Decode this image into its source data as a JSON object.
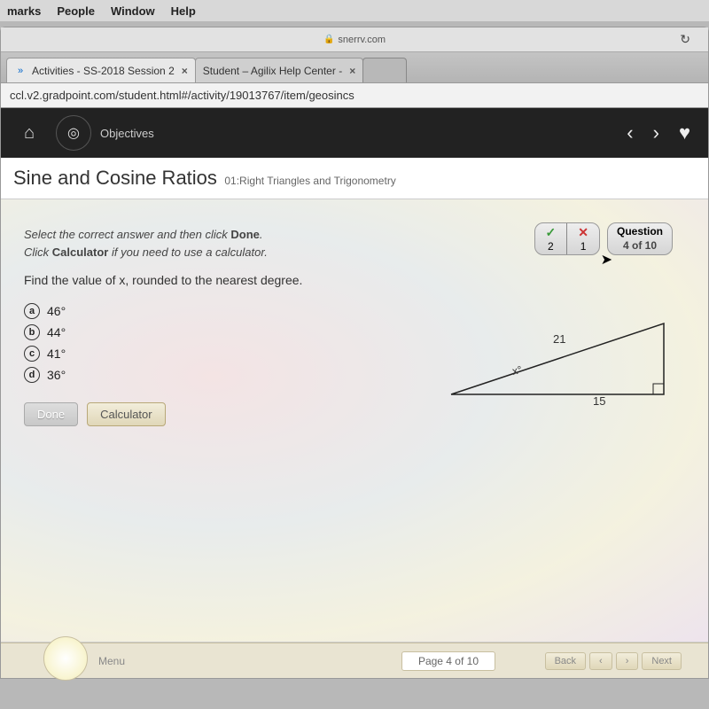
{
  "menubar": {
    "items": [
      "marks",
      "People",
      "Window",
      "Help"
    ]
  },
  "stacked": {
    "domain": "snerrv.com"
  },
  "tabs": [
    {
      "title": "Activities - SS-2018 Session 2",
      "active": true
    },
    {
      "title": "Student – Agilix Help Center -",
      "active": false
    }
  ],
  "url": "ccl.v2.gradpoint.com/student.html#/activity/19013767/item/geosincs",
  "nav": {
    "objectives": "Objectives"
  },
  "page": {
    "title": "Sine and Cosine Ratios",
    "subtitle": "01:Right Triangles and Trigonometry"
  },
  "instruction": {
    "line1_a": "Select the correct answer and then click ",
    "line1_b": "Done",
    "line2_a": "Click ",
    "line2_b": "Calculator",
    "line2_c": " if you need to use a calculator."
  },
  "question": "Find the value of x, rounded to the nearest degree.",
  "choices": [
    {
      "marker": "a",
      "text": "46°"
    },
    {
      "marker": "b",
      "text": "44°"
    },
    {
      "marker": "c",
      "text": "41°"
    },
    {
      "marker": "d",
      "text": "36°"
    }
  ],
  "buttons": {
    "done": "Done",
    "calc": "Calculator"
  },
  "scores": {
    "correct": "2",
    "wrong": "1",
    "q_label": "Question",
    "q_pos": "4 of 10"
  },
  "triangle": {
    "hyp": "21",
    "base": "15",
    "angle": "x°"
  },
  "footer": {
    "menu": "Menu",
    "page": "Page 4 of 10",
    "back": "Back",
    "next": "Next"
  }
}
